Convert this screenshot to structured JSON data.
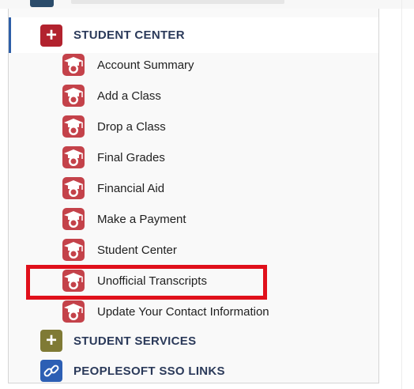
{
  "colors": {
    "active_indicator": "#2e5fa8",
    "student_center_icon": "#b2222e",
    "student_services_icon": "#7f7a35",
    "peoplesoft_icon": "#2d5fb4",
    "highlight": "#e0101b",
    "graduate_icon": "#c4424a"
  },
  "nav": {
    "student_center": {
      "label": "STUDENT CENTER",
      "icon": "plus-icon",
      "items": [
        {
          "label": "Account Summary",
          "icon": "graduate-cap-icon"
        },
        {
          "label": "Add a Class",
          "icon": "graduate-cap-icon"
        },
        {
          "label": "Drop a Class",
          "icon": "graduate-cap-icon"
        },
        {
          "label": "Final Grades",
          "icon": "graduate-cap-icon"
        },
        {
          "label": "Financial Aid",
          "icon": "graduate-cap-icon"
        },
        {
          "label": "Make a Payment",
          "icon": "graduate-cap-icon"
        },
        {
          "label": "Student Center",
          "icon": "graduate-cap-icon"
        },
        {
          "label": "Unofficial Transcripts",
          "icon": "graduate-cap-icon",
          "highlighted": true
        },
        {
          "label": "Update Your Contact Information",
          "icon": "graduate-cap-icon"
        }
      ]
    },
    "student_services": {
      "label": "STUDENT SERVICES",
      "icon": "plus-icon"
    },
    "peoplesoft_sso_links": {
      "label": "PEOPLESOFT SSO LINKS",
      "icon": "link-icon"
    }
  }
}
